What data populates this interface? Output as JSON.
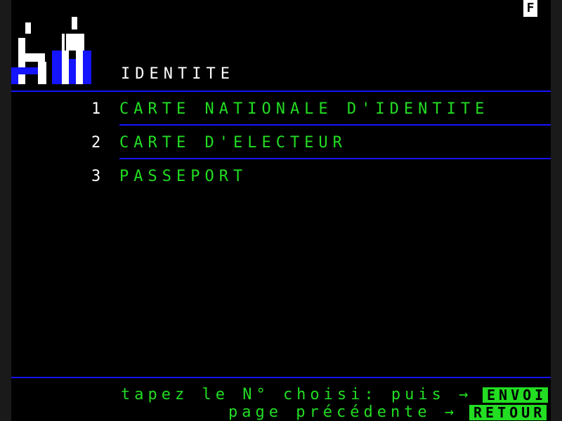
{
  "header": {
    "mode_indicator": "F",
    "title": "IDENTITE"
  },
  "logo": {
    "icon": "people-icon",
    "colors": [
      "#ffffff",
      "#1414ff"
    ]
  },
  "menu": {
    "items": [
      {
        "number": "1",
        "label": "CARTE NATIONALE D'IDENTITE"
      },
      {
        "number": "2",
        "label": "CARTE D'ELECTEUR"
      },
      {
        "number": "3",
        "label": "PASSEPORT"
      }
    ]
  },
  "footer": {
    "line1": "tapez le N° choisi: puis →",
    "line1_key": "ENVOI",
    "line2": "page précédente →",
    "line2_key": "RETOUR"
  },
  "colors": {
    "background": "#000000",
    "text_green": "#22dd22",
    "rule_blue": "#1414ff",
    "text_white": "#ffffff"
  }
}
